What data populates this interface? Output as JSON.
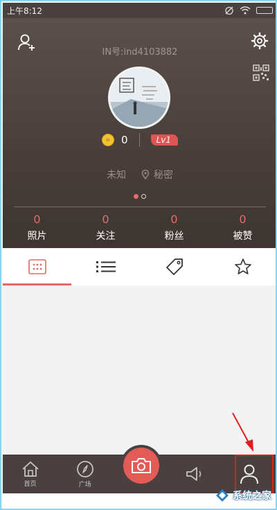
{
  "status_bar": {
    "time": "上午8:12"
  },
  "profile": {
    "in_id": "IN号:ind4103882",
    "coin_count": "0",
    "level": "Lv1",
    "gender": "未知",
    "location": "秘密",
    "pager": {
      "total": 2,
      "active": 1
    }
  },
  "stats": [
    {
      "value": "0",
      "label": "照片"
    },
    {
      "value": "0",
      "label": "关注"
    },
    {
      "value": "0",
      "label": "粉丝"
    },
    {
      "value": "0",
      "label": "被赞"
    }
  ],
  "tabs": [
    {
      "icon": "grid-icon",
      "active": true
    },
    {
      "icon": "list-icon",
      "active": false
    },
    {
      "icon": "tag-icon",
      "active": false
    },
    {
      "icon": "star-icon",
      "active": false
    }
  ],
  "bottom_nav": {
    "home_label": "首页",
    "plaza_label": "广场",
    "camera_icon": "camera-icon",
    "notify_icon": "speaker-icon",
    "me_icon": "user-icon"
  },
  "watermark": {
    "text": "系统之家"
  },
  "colors": {
    "accent": "#e35a57",
    "header_bg": "#4a403b",
    "nav_bg": "#4a4040",
    "highlight": "#e01e1e"
  }
}
